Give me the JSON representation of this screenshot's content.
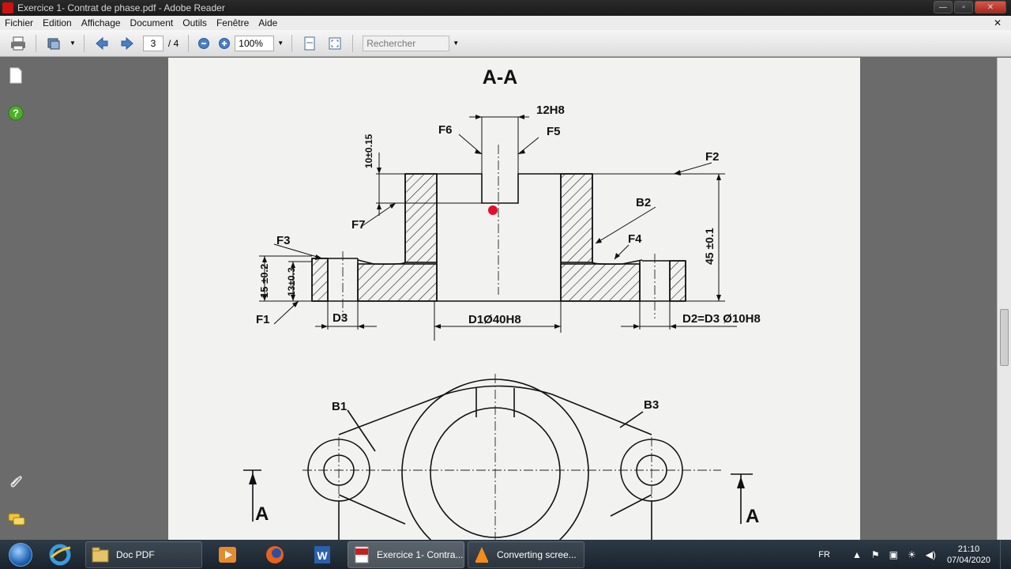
{
  "window": {
    "title": "Exercice 1- Contrat de phase.pdf - Adobe Reader",
    "controls": {
      "minimize": "—",
      "maximize": "▫",
      "close": "✕"
    }
  },
  "menu": {
    "items": [
      "Fichier",
      "Edition",
      "Affichage",
      "Document",
      "Outils",
      "Fenêtre",
      "Aide"
    ],
    "close_doc": "✕"
  },
  "toolbar": {
    "current_page": "3",
    "total_pages": "/ 4",
    "zoom": "100%",
    "search_placeholder": "Rechercher"
  },
  "drawing": {
    "section_title": "A-A",
    "labels": {
      "h12": "12H8",
      "f6": "F6",
      "f5": "F5",
      "f2": "F2",
      "tol10": "10±0.15",
      "b2": "B2",
      "f7": "F7",
      "f4": "F4",
      "f3": "F3",
      "dim45": "45 ±0.1",
      "dim15": "15 ±0.2",
      "dim13": "13±0.3",
      "f1": "F1",
      "d3": "D3",
      "d1": "D1Ø40H8",
      "d2": "D2=D3 Ø10H8",
      "b1": "B1",
      "b3": "B3",
      "a_left": "A",
      "a_right": "A"
    },
    "marker_color": "#e0102a"
  },
  "taskbar": {
    "tasks": [
      {
        "label": "Doc PDF"
      },
      {
        "label": "Exercice 1- Contra..."
      },
      {
        "label": "Converting scree..."
      }
    ],
    "tray": {
      "language": "FR",
      "time": "21:10",
      "date": "07/04/2020"
    }
  }
}
